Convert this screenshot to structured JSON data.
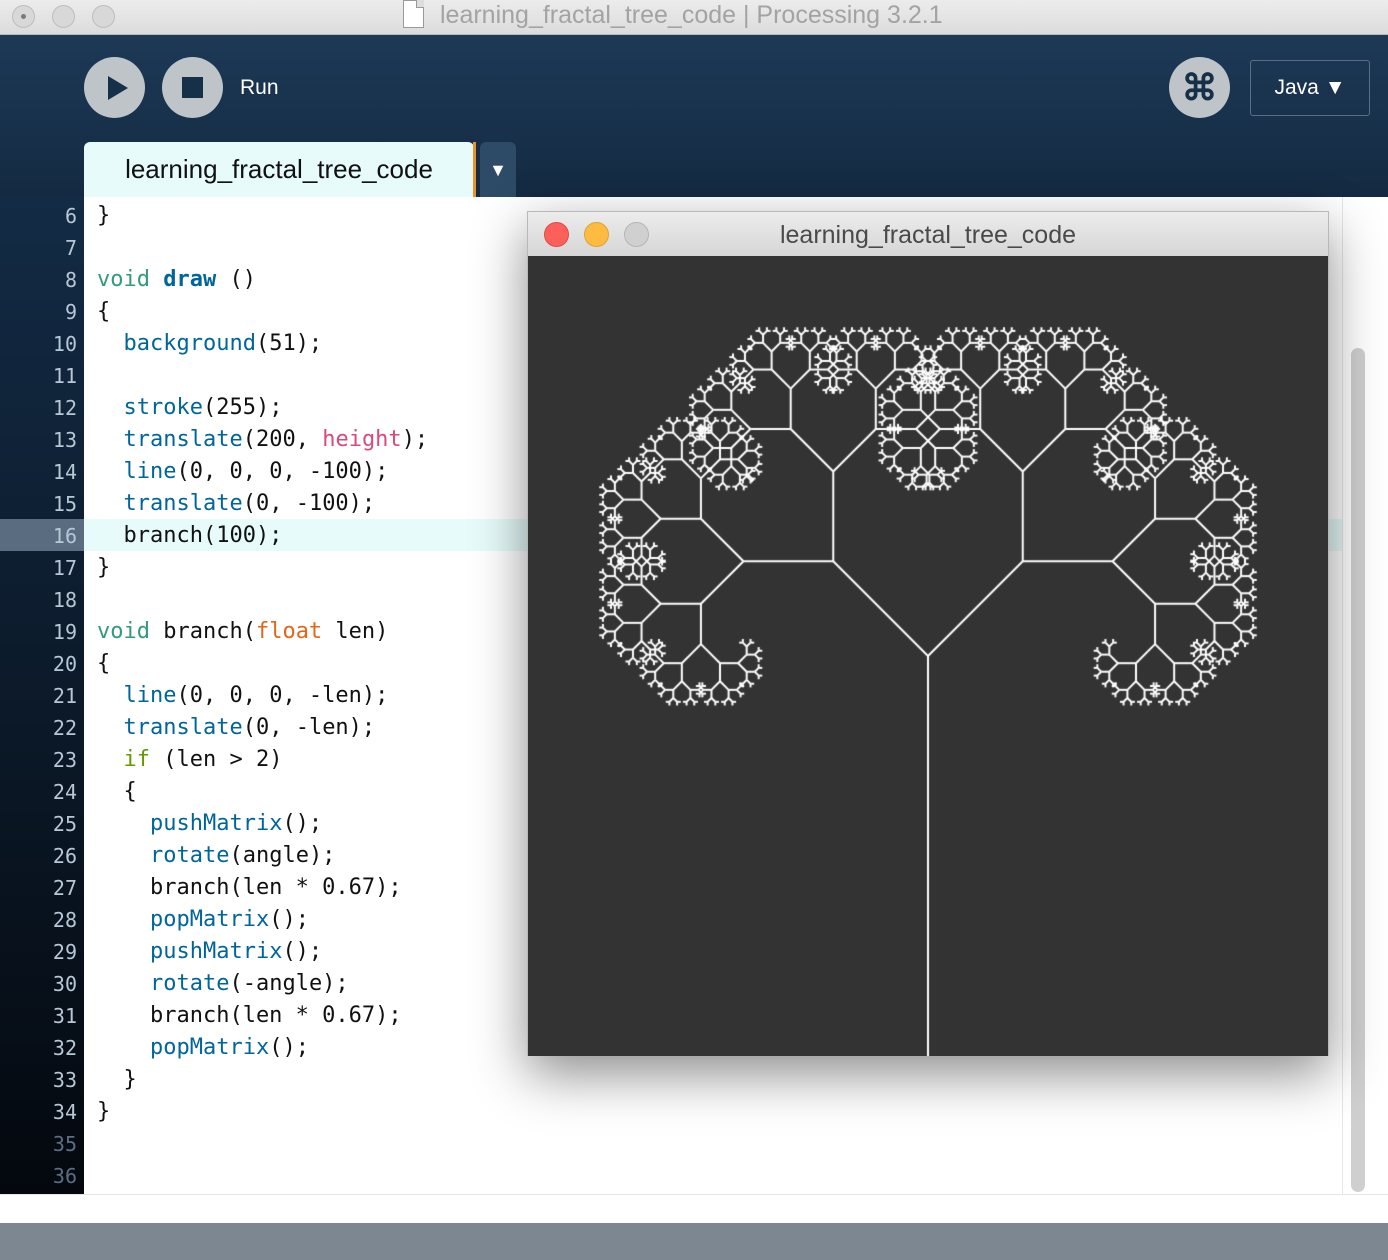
{
  "window": {
    "title": "learning_fractal_tree_code | Processing 3.2.1"
  },
  "toolbar": {
    "run_label": "Run",
    "mode": "Java ▼",
    "debug_symbol": "⌘"
  },
  "tab": {
    "name": "learning_fractal_tree_code",
    "menu_arrow": "▼"
  },
  "editor": {
    "current_line": 16,
    "line_numbers": [
      "6",
      "7",
      "8",
      "9",
      "10",
      "11",
      "12",
      "13",
      "14",
      "15",
      "16",
      "17",
      "18",
      "19",
      "20",
      "21",
      "22",
      "23",
      "24",
      "25",
      "26",
      "27",
      "28",
      "29",
      "30",
      "31",
      "32",
      "33",
      "34",
      "35",
      "36"
    ]
  },
  "sketch_window": {
    "title": "learning_fractal_tree_code",
    "background": "#333333",
    "stroke": "#ffffff",
    "trunk_length": 100,
    "branch_scale": 0.67,
    "min_length": 2
  }
}
